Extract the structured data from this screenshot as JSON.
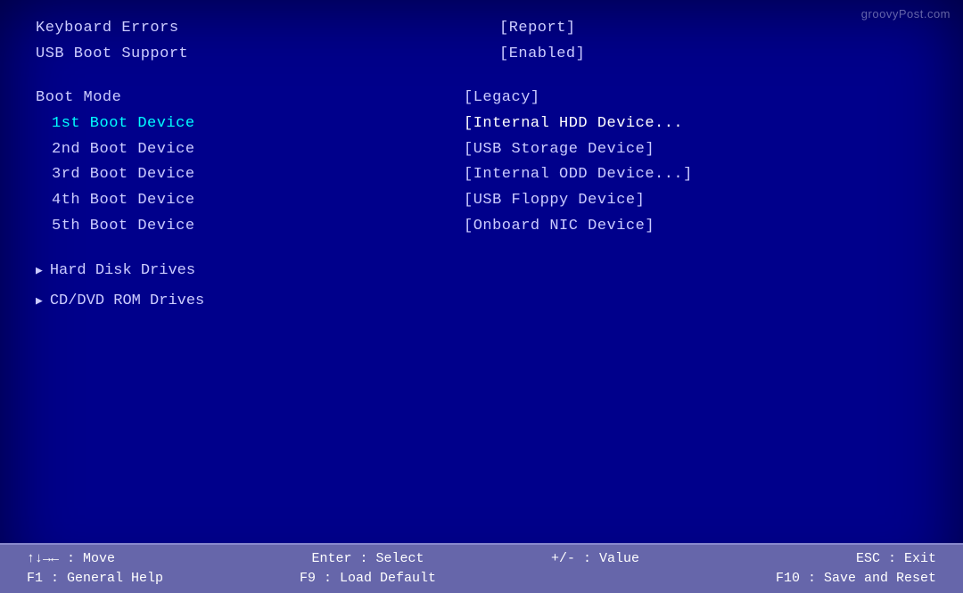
{
  "watermark": "groovyPost.com",
  "top_items": [
    {
      "label": "Keyboard Errors",
      "value": "[Report]"
    },
    {
      "label": "USB Boot Support",
      "value": "[Enabled]"
    }
  ],
  "boot_mode": {
    "label": "Boot Mode",
    "value": "[Legacy]"
  },
  "boot_devices": [
    {
      "label": "1st Boot Device",
      "value": "[Internal HDD Device...",
      "highlighted": true
    },
    {
      "label": "2nd Boot Device",
      "value": "[USB Storage Device]"
    },
    {
      "label": "3rd Boot Device",
      "value": "[Internal ODD Device...]"
    },
    {
      "label": "4th Boot Device",
      "value": "[USB Floppy Device]"
    },
    {
      "label": "5th Boot Device",
      "value": "[Onboard NIC Device]"
    }
  ],
  "submenu_items": [
    {
      "label": "Hard Disk Drives"
    },
    {
      "label": "CD/DVD ROM Drives"
    }
  ],
  "status_bar": [
    {
      "line1": "↑↓→← : Move",
      "line2": "F1 : General Help"
    },
    {
      "line1": "Enter : Select",
      "line2": "F9 : Load Default"
    },
    {
      "line1": "+/- : Value",
      "line2": ""
    },
    {
      "line1": "ESC : Exit",
      "line2": "F10 : Save and Reset"
    }
  ]
}
